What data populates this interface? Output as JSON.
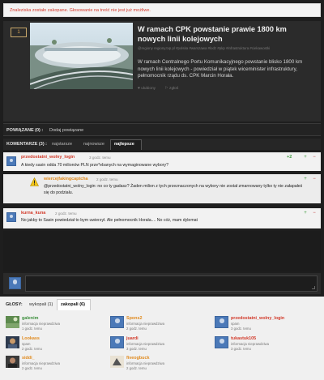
{
  "alert": {
    "text": "Znaleziska zostało zakopane. Głosowanie na treść nie jest już możliwe."
  },
  "article": {
    "vote_count": "1",
    "title": "W ramach CPK powstanie prawie 1800 km nowych linii kolejowych",
    "meta": "@regiony  regiony.tvp.pl   #polska  #warszawa  #lodz  #pkp  #infrastruktura  #ciekawostki",
    "body": "W ramach Centralnego Portu Komunikacyjnego powstanie blisko 1800 km nowych linii kolejowych - powiedział w piątek wiceminister infrastruktury, pełnomocnik rządu ds. CPK Marcin Horała.",
    "actions": [
      "ulubiony",
      "zgłoś"
    ]
  },
  "related": {
    "label": "POWIĄZANE (0) :",
    "add": "Dodaj powiązane"
  },
  "comments": {
    "label": "KOMENTARZE (3) :",
    "sort": [
      "najstarsze",
      "najnowsze",
      "najlepsze"
    ],
    "items": [
      {
        "author": "przedostatni_wolny_login",
        "time": "3 godz. temu",
        "text": "A kiedy sasin odda 70 milionów PLN prze*ebanych na wymaginowane wybory?",
        "votes": "+2"
      },
      {
        "author": "wiercejfakingcaptcha",
        "time": "2 godz. temu",
        "text": "@przedostatni_wolny_login: no co ty gadasz? Żaden milion z tych przeznaczonych na wybory nie został zmarnowany tylko ty nie załapałeś się do podziału."
      },
      {
        "author": "kurna_kuna",
        "time": "2 godz. temu",
        "text": "No jakby to Sasin powiedział to bym uwierzył. Ale pełnomocnik Horała.... No cóż, mam dylemat"
      }
    ]
  },
  "votes": {
    "label": "GŁOSY:",
    "tabs": [
      "wykopali (1)",
      "zakopali (6)"
    ],
    "voters": [
      {
        "name": "galenim",
        "reason": "informacja nieprawdziwa",
        "time": "1 godz. temu"
      },
      {
        "name": "Spons2",
        "reason": "informacja nieprawdziwa",
        "time": "2 godz. temu"
      },
      {
        "name": "przedostatni_wolny_login",
        "reason": "spam",
        "time": "3 godz. temu"
      },
      {
        "name": "Lookass",
        "reason": "spam",
        "time": "2 godz. temu"
      },
      {
        "name": "juardi",
        "reason": "informacja nieprawdziwa",
        "time": "3 godz. temu"
      },
      {
        "name": "tukastuk105",
        "reason": "informacja nieprawdziwa",
        "time": "3 godz. temu"
      },
      {
        "name": "siddi_",
        "reason": "informacja nieprawdziwa",
        "time": "2 godz. temu"
      },
      {
        "name": "fiveogbuck",
        "reason": "informacja nieprawdziwa",
        "time": "2 godz. temu"
      }
    ]
  }
}
